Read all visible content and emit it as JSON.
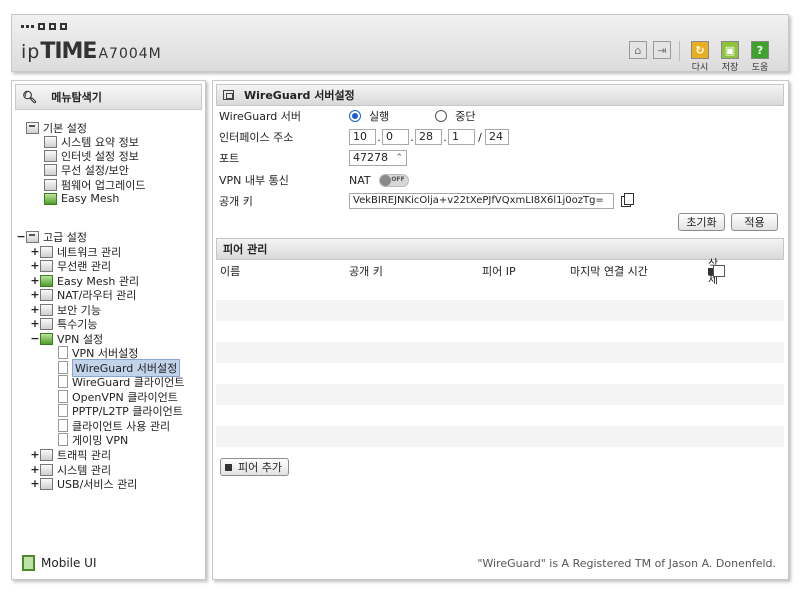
{
  "header": {
    "logo_ip": "ip",
    "logo_time": "TIME",
    "logo_model": "A7004M",
    "buttons": [
      {
        "label": "다시",
        "color": "#e8b020",
        "glyph": "↻"
      },
      {
        "label": "저장",
        "color": "#8cc43c",
        "glyph": "▣"
      },
      {
        "label": "도움",
        "color": "#3ea32b",
        "glyph": "?"
      }
    ]
  },
  "left": {
    "title": "메뉴탐색기",
    "basic": {
      "label": "기본 설정",
      "items": [
        "시스템 요약 정보",
        "인터넷 설정 정보",
        "무선 설정/보안",
        "펌웨어 업그레이드",
        "Easy Mesh"
      ]
    },
    "advanced": {
      "label": "고급 설정",
      "groups": [
        "네트워크 관리",
        "무선랜 관리",
        "Easy Mesh 관리",
        "NAT/라우터 관리",
        "보안 기능",
        "특수기능",
        "VPN 설정"
      ],
      "vpn_items": [
        "VPN 서버설정",
        "WireGuard 서버설정",
        "WireGuard 클라이언트",
        "OpenVPN 클라이언트",
        "PPTP/L2TP 클라이언트",
        "클라이언트 사용 관리",
        "게이밍 VPN"
      ],
      "groups_after": [
        "트래픽 관리",
        "시스템 관리",
        "USB/서비스 관리"
      ]
    },
    "mobile_label": "Mobile UI"
  },
  "main": {
    "section_title": "WireGuard 서버설정",
    "server": {
      "label": "WireGuard 서버",
      "run_label": "실행",
      "stop_label": "중단",
      "selected": "실행"
    },
    "interface": {
      "label": "인터페이스 주소",
      "octets": [
        "10",
        "0",
        "28",
        "1"
      ],
      "mask": "24"
    },
    "port": {
      "label": "포트",
      "value": "47278"
    },
    "vpn_internal": {
      "label": "VPN 내부 통신",
      "nat_label": "NAT",
      "toggle_text": "OFF"
    },
    "public_key": {
      "label": "공개 키",
      "value": "VekBIREJNKicOlja+v22tXePJfVQxmLI8X6l1j0ozTg="
    },
    "reset_button": "초기화",
    "apply_button": "적용",
    "peer_section_title": "피어 관리",
    "peer_columns": {
      "name": "이름",
      "public_key": "공개 키",
      "peer_ip": "피어 IP",
      "last_connect": "마지막 연결 시간",
      "delete": "삭제"
    },
    "add_peer_button": "피어 추가",
    "footer_note": "\"WireGuard\" is A Registered TM of Jason A. Donenfeld."
  }
}
